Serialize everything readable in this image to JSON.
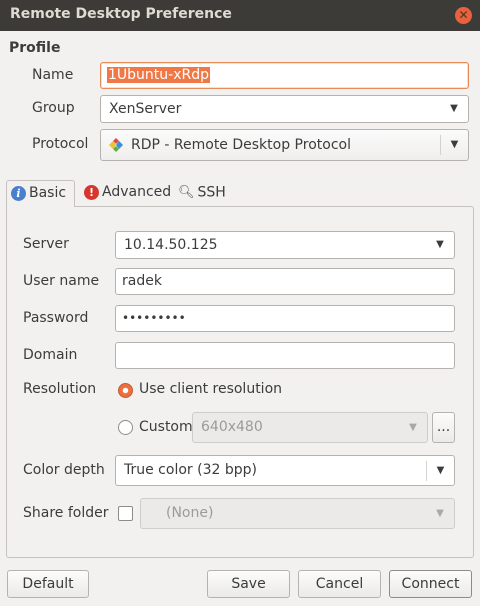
{
  "window": {
    "title": "Remote Desktop Preference"
  },
  "profile": {
    "section_title": "Profile",
    "name_label": "Name",
    "name_value": "1Ubuntu-xRdp",
    "group_label": "Group",
    "group_value": "XenServer",
    "protocol_label": "Protocol",
    "protocol_value": "RDP - Remote Desktop Protocol"
  },
  "tabs": [
    {
      "label": "Basic",
      "icon": "info-icon",
      "active": true
    },
    {
      "label": "Advanced",
      "icon": "warning-icon",
      "active": false
    },
    {
      "label": "SSH",
      "icon": "search-icon",
      "active": false
    }
  ],
  "basic": {
    "server_label": "Server",
    "server_value": "10.14.50.125",
    "username_label": "User name",
    "username_value": "radek",
    "password_label": "Password",
    "password_value": "•••••••••",
    "domain_label": "Domain",
    "domain_value": "",
    "resolution_label": "Resolution",
    "resolution_client_label": "Use client resolution",
    "resolution_custom_label": "Custom",
    "resolution_custom_value": "640x480",
    "resolution_more_label": "...",
    "color_depth_label": "Color depth",
    "color_depth_value": "True color (32 bpp)",
    "share_folder_label": "Share folder",
    "share_folder_value": "(None)"
  },
  "buttons": {
    "default_label": "Default",
    "save_label": "Save",
    "cancel_label": "Cancel",
    "connect_label": "Connect"
  },
  "colors": {
    "titlebar": "#3c3b37",
    "accent": "#f07746",
    "close": "#e8613a"
  }
}
